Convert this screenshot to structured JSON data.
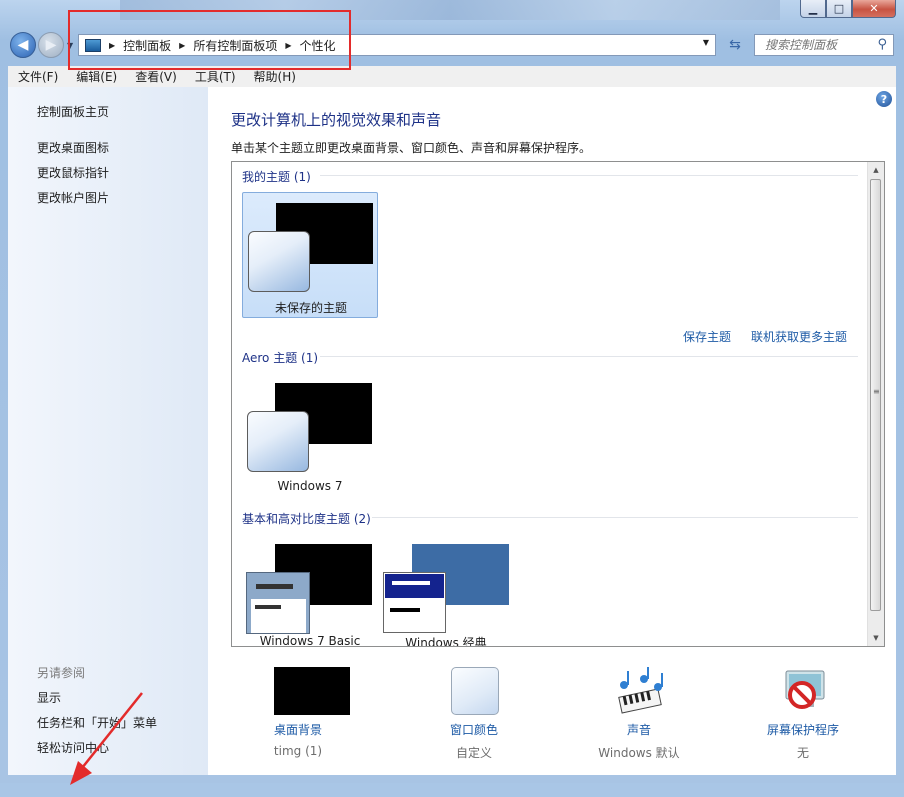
{
  "window": {
    "caption_minimize": "▁",
    "caption_maximize": "□",
    "caption_close": "✕"
  },
  "address": {
    "crumbs": [
      "控制面板",
      "所有控制面板项",
      "个性化"
    ],
    "search_placeholder": "搜索控制面板"
  },
  "menu": [
    "文件(F)",
    "编辑(E)",
    "查看(V)",
    "工具(T)",
    "帮助(H)"
  ],
  "sidebar": {
    "links": [
      "控制面板主页",
      "更改桌面图标",
      "更改鼠标指针",
      "更改帐户图片"
    ],
    "see_also": "另请参阅",
    "see_also_links": [
      "显示",
      "任务栏和「开始」菜单",
      "轻松访问中心"
    ]
  },
  "main": {
    "title": "更改计算机上的视觉效果和声音",
    "description": "单击某个主题立即更改桌面背景、窗口颜色、声音和屏幕保护程序。",
    "groups": [
      {
        "header": "我的主题 (1)",
        "themes": [
          "未保存的主题"
        ],
        "links": [
          "保存主题",
          "联机获取更多主题"
        ]
      },
      {
        "header": "Aero 主题 (1)",
        "themes": [
          "Windows 7"
        ]
      },
      {
        "header": "基本和高对比度主题 (2)",
        "themes": [
          "Windows 7 Basic",
          "Windows 经典"
        ]
      }
    ],
    "settings": [
      {
        "label": "桌面背景",
        "value": "timg (1)"
      },
      {
        "label": "窗口颜色",
        "value": "自定义"
      },
      {
        "label": "声音",
        "value": "Windows 默认"
      },
      {
        "label": "屏幕保护程序",
        "value": "无"
      }
    ]
  },
  "colors": {
    "link": "#1e5ba6",
    "title": "#1e3287",
    "annotation": "#e32b2b"
  },
  "icons": [
    "back-icon",
    "forward-icon",
    "control-panel-icon",
    "refresh-icon",
    "search-icon",
    "help-icon",
    "music-notes-icon",
    "screensaver-icon"
  ]
}
